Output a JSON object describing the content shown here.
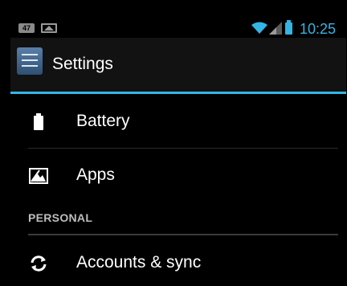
{
  "status_bar": {
    "notification_count": "47",
    "image_notification": "picture-icon",
    "time": "10:25",
    "accent_color": "#33b5e5"
  },
  "action_bar": {
    "title": "Settings",
    "icon": "settings-sliders-icon"
  },
  "items": [
    {
      "label": "Battery",
      "icon": "battery-icon"
    },
    {
      "label": "Apps",
      "icon": "apps-icon"
    }
  ],
  "personal_section": {
    "header": "PERSONAL",
    "items": [
      {
        "label": "Accounts & sync",
        "icon": "sync-icon"
      }
    ]
  }
}
